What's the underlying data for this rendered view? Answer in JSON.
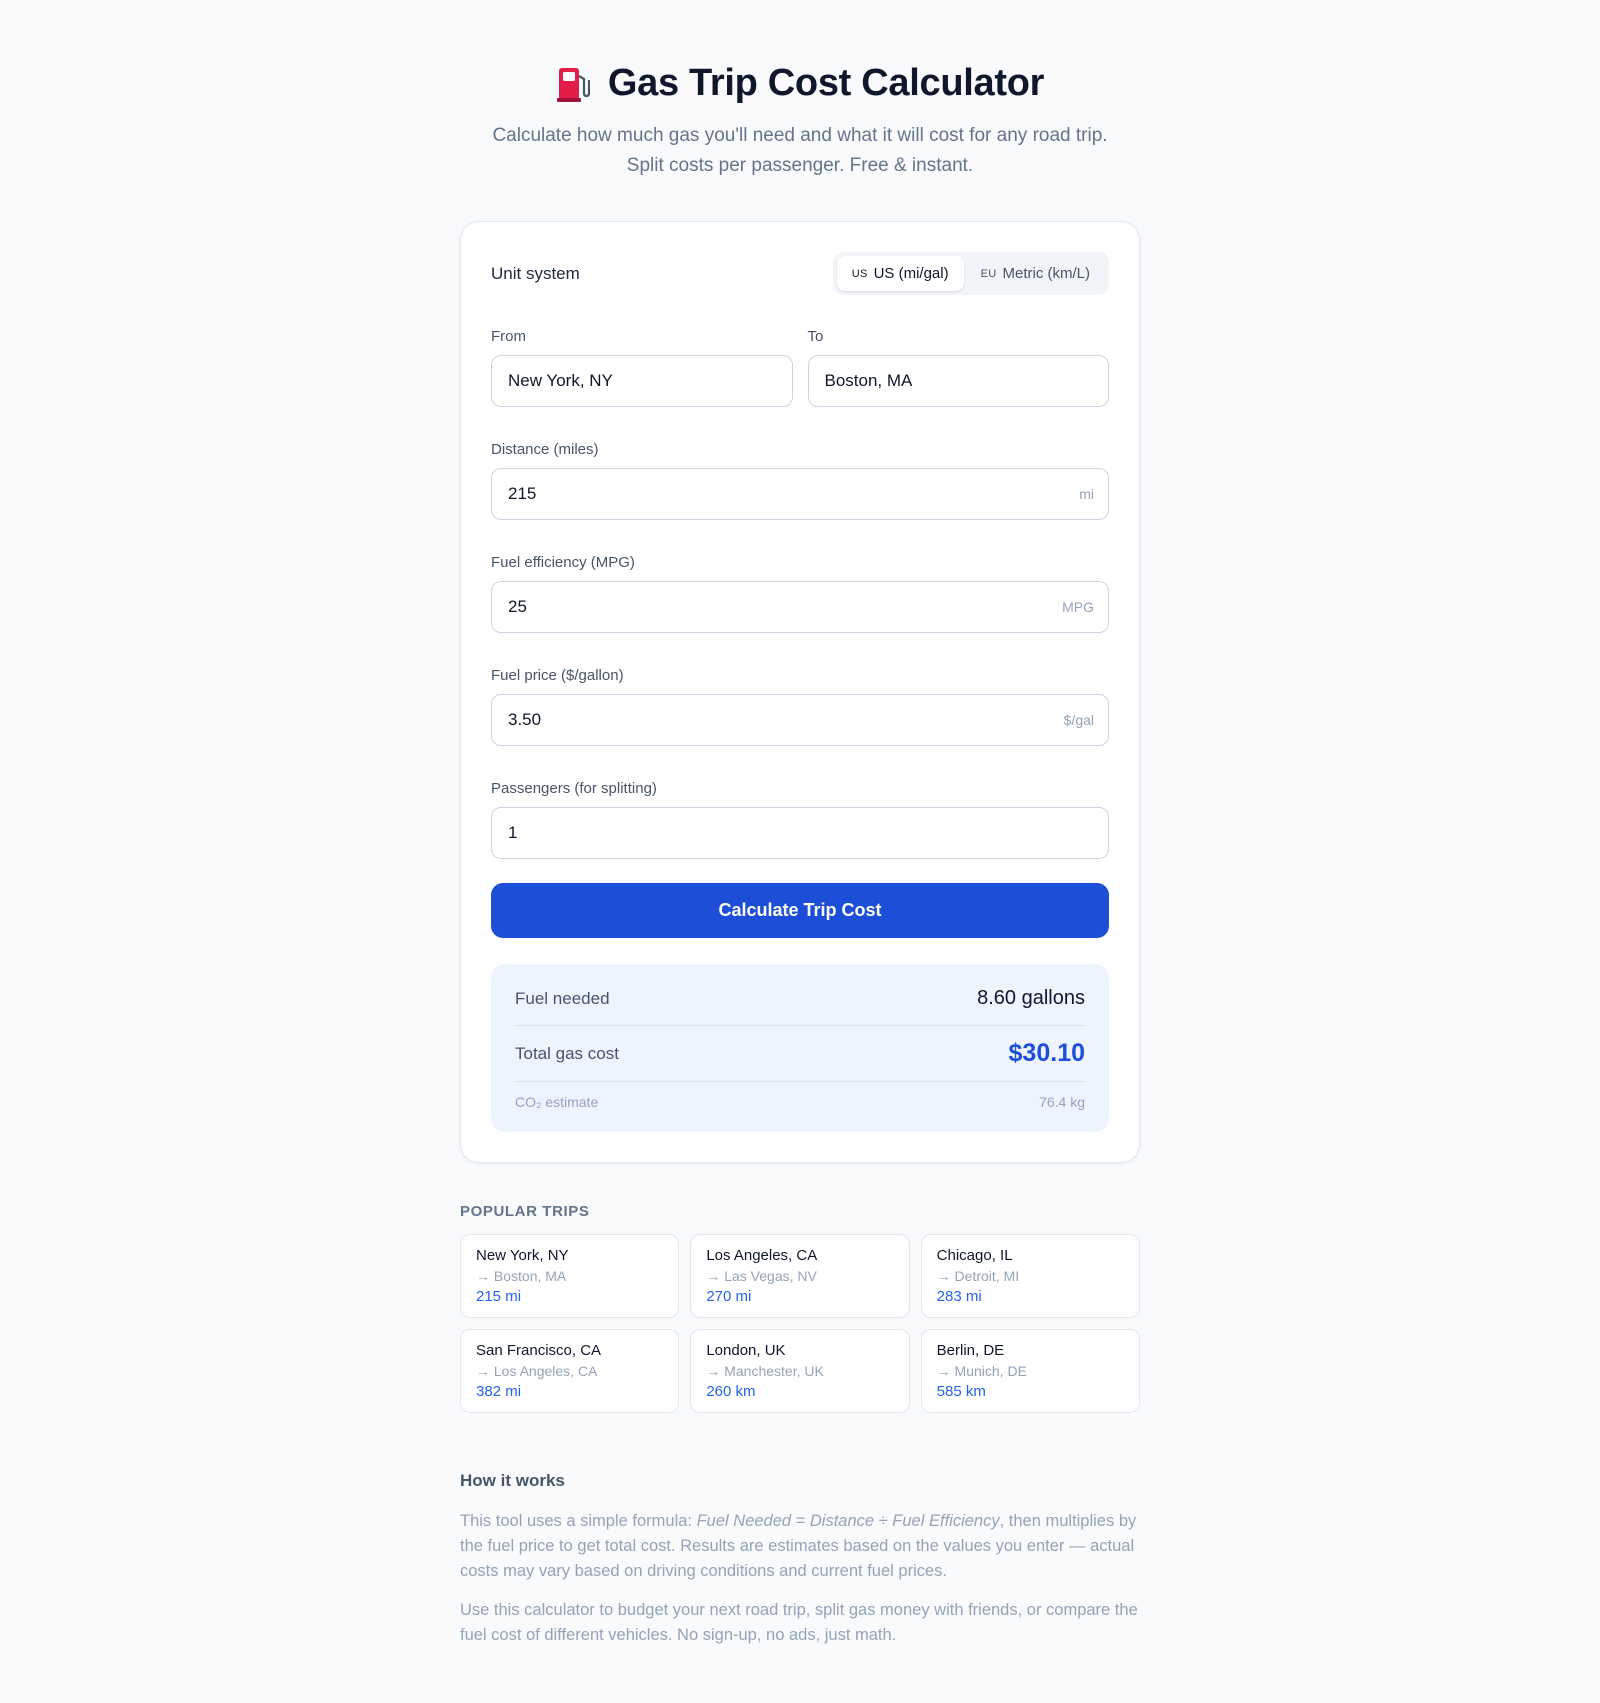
{
  "header": {
    "title": "Gas Trip Cost Calculator",
    "subtitle_line1": "Calculate how much gas you'll need and what it will cost for any road trip.",
    "subtitle_line2": "Split costs per passenger. Free & instant.",
    "icon": "fuel-pump-icon"
  },
  "units": {
    "label": "Unit system",
    "options": [
      {
        "flag": "US",
        "label": "US (mi/gal)",
        "active": true
      },
      {
        "flag": "EU",
        "label": "Metric (km/L)",
        "active": false
      }
    ]
  },
  "form": {
    "from": {
      "label": "From",
      "value": "New York, NY"
    },
    "to": {
      "label": "To",
      "value": "Boston, MA"
    },
    "distance": {
      "label": "Distance (miles)",
      "value": "215",
      "suffix": "mi"
    },
    "efficiency": {
      "label": "Fuel efficiency (MPG)",
      "value": "25",
      "suffix": "MPG"
    },
    "price": {
      "label": "Fuel price ($/gallon)",
      "value": "3.50",
      "suffix": "$/gal"
    },
    "passengers": {
      "label": "Passengers (for splitting)",
      "value": "1"
    },
    "submit_label": "Calculate Trip Cost"
  },
  "results": {
    "fuel_label": "Fuel needed",
    "fuel_value": "8.60 gallons",
    "total_label": "Total gas cost",
    "total_value": "$30.10",
    "co2_label": "CO₂ estimate",
    "co2_value": "76.4 kg"
  },
  "popular": {
    "title": "POPULAR TRIPS",
    "trips": [
      {
        "from": "New York, NY",
        "to": "→ Boston, MA",
        "distance": "215 mi"
      },
      {
        "from": "Los Angeles, CA",
        "to": "→ Las Vegas, NV",
        "distance": "270 mi"
      },
      {
        "from": "Chicago, IL",
        "to": "→ Detroit, MI",
        "distance": "283 mi"
      },
      {
        "from": "San Francisco, CA",
        "to": "→ Los Angeles, CA",
        "distance": "382 mi"
      },
      {
        "from": "London, UK",
        "to": "→ Manchester, UK",
        "distance": "260 km"
      },
      {
        "from": "Berlin, DE",
        "to": "→ Munich, DE",
        "distance": "585 km"
      }
    ]
  },
  "how": {
    "title": "How it works",
    "p1_a": "This tool uses a simple formula: ",
    "p1_formula": "Fuel Needed = Distance ÷ Fuel Efficiency",
    "p1_b": ", then multiplies by the fuel price to get total cost. Results are estimates based on the values you enter — actual costs may vary based on driving conditions and current fuel prices.",
    "p2": "Use this calculator to budget your next road trip, split gas money with friends, or compare the fuel cost of different vehicles. No sign-up, no ads, just math."
  },
  "colors": {
    "accent": "#1d4ed8",
    "link": "#2563eb",
    "results_bg": "#eef4ff",
    "page_bg": "#f8fafc"
  }
}
